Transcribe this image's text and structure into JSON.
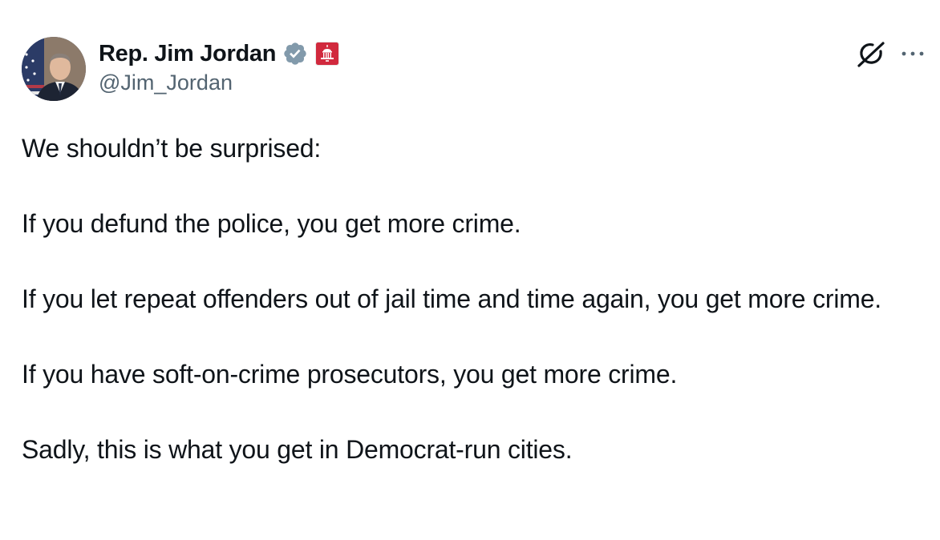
{
  "author": {
    "display_name": "Rep. Jim Jordan",
    "handle": "@Jim_Jordan",
    "verified_icon": "verified-badge-icon",
    "affiliation_icon": "us-government-capitol-icon"
  },
  "actions": {
    "grok_icon": "grok-icon",
    "more_icon": "more-horizontal-icon"
  },
  "tweet": {
    "paragraphs": [
      "We shouldn’t be surprised:",
      "If you defund the police, you get more crime.",
      "If you let repeat offenders out of jail time and time again, you get more crime.",
      "If you have soft-on-crime prosecutors, you get more crime.",
      "Sadly, this is what you get in Democrat-run cities."
    ]
  },
  "colors": {
    "text_primary": "#0f1419",
    "text_secondary": "#536471",
    "verified_badge": "#829aab",
    "affiliation_badge": "#d1293d"
  }
}
